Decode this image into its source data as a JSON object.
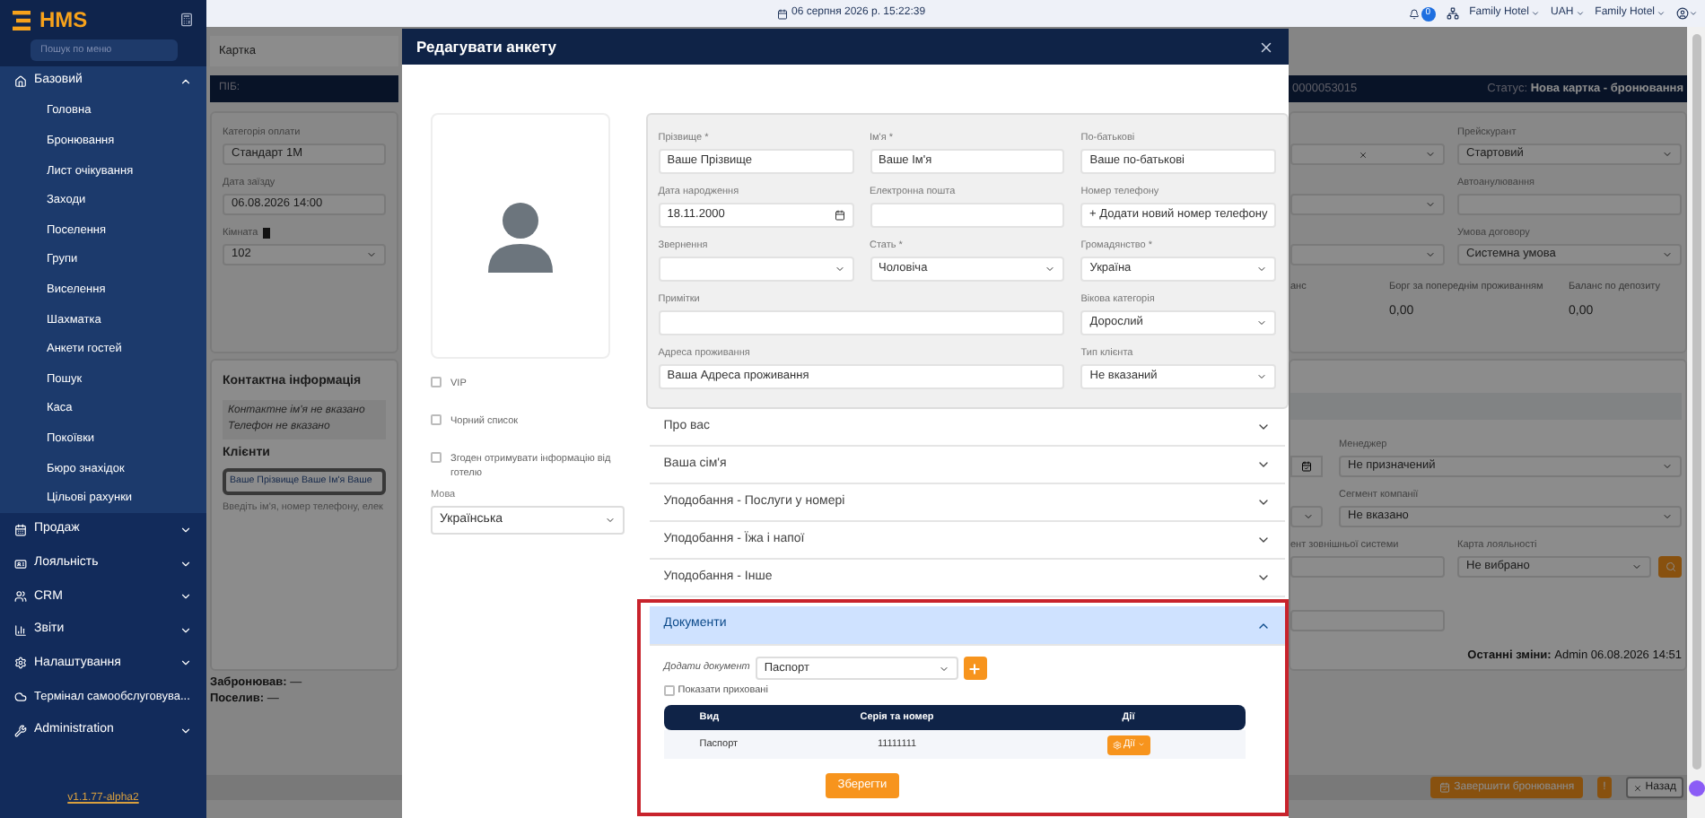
{
  "sidebar": {
    "logo": "HMS",
    "search_placeholder": "Пошук по меню",
    "items": [
      {
        "label": "Базовий",
        "kind": "group",
        "expanded": true,
        "children": [
          {
            "label": "Головна"
          },
          {
            "label": "Бронювання"
          },
          {
            "label": "Лист очікування"
          },
          {
            "label": "Заходи"
          },
          {
            "label": "Поселення"
          },
          {
            "label": "Групи"
          },
          {
            "label": "Виселення"
          },
          {
            "label": "Шахматка"
          },
          {
            "label": "Анкети гостей"
          },
          {
            "label": "Пошук"
          },
          {
            "label": "Каса"
          },
          {
            "label": "Покоївки"
          },
          {
            "label": "Бюро знахідок"
          },
          {
            "label": "Цільові рахунки"
          }
        ]
      },
      {
        "label": "Продаж",
        "kind": "group",
        "expanded": false
      },
      {
        "label": "Лояльність",
        "kind": "group",
        "expanded": false
      },
      {
        "label": "CRM",
        "kind": "group",
        "expanded": false
      },
      {
        "label": "Звіти",
        "kind": "group",
        "expanded": false
      },
      {
        "label": "Налаштування",
        "kind": "group",
        "expanded": false
      },
      {
        "label": "Термінал самообслуговува...",
        "kind": "link"
      },
      {
        "label": "Administration",
        "kind": "group",
        "expanded": false
      }
    ],
    "version": "v1.1.77-alpha2"
  },
  "topbar": {
    "datetime": "06 серпня 2026 р. 15:22:39",
    "notifications": "0",
    "menus": [
      "Family Hotel",
      "UAH",
      "Family Hotel"
    ]
  },
  "background": {
    "tab": "Картка",
    "left": {
      "name_label": "ПІБ:",
      "fields": [
        {
          "label": "Категорія оплати",
          "value": "Стандарт 1М",
          "kind": "input"
        },
        {
          "label": "Дата заїзду",
          "value": "06.08.2026 14:00",
          "kind": "input"
        },
        {
          "label": "Кімната",
          "value": "102",
          "kind": "select"
        }
      ],
      "contact_title": "Контактна інформація",
      "contact_name": "Контактне ім'я не вказано",
      "contact_phone": "Телефон не вказано",
      "clients_title": "Клієнти",
      "client_value": "Ваше Прізвище Ваше Ім'я Ваше",
      "client_hint": "Введіть ім'я, номер телефону, елек",
      "booked_by": "Забронював:",
      "booked_by_value": "—",
      "settled_by": "Поселив:",
      "settled_by_value": "—"
    },
    "right": {
      "card_number": "0000053015",
      "status_label": "Статус:",
      "status_value": "Нова картка - бронювання",
      "fields": [
        {
          "label": "Прейскурант",
          "value": "Стартовий",
          "kind": "select"
        },
        {
          "label": "Автоанулювання",
          "kind": "input"
        },
        {
          "label": "Умова договору",
          "value": "Системна умова",
          "kind": "select"
        }
      ],
      "balances": [
        {
          "label": "анс"
        },
        {
          "label": "Борг за попереднім проживанням",
          "value": "0,00"
        },
        {
          "label": "Баланс по депозиту",
          "value": "0,00"
        }
      ],
      "manager_label": "Менеджер",
      "manager_value": "Не призначений",
      "segment_label": "Сегмент компанії",
      "segment_value": "Не вказано",
      "external_label": "ент зовнішньої системи",
      "loyalty_label": "Карта лояльності",
      "loyalty_value": "Не вибрано",
      "last_change_label": "Останні зміни:",
      "last_change_value": "Admin 06.08.2026 14:51"
    },
    "footer_buttons": [
      {
        "label": "Завершити бронювання",
        "kind": "primary"
      },
      {
        "label": "!",
        "kind": "warning"
      },
      {
        "label": "Назад",
        "kind": "back"
      }
    ]
  },
  "modal": {
    "title": "Редагувати анкету",
    "flags": [
      {
        "label": "VIP",
        "checked": false
      },
      {
        "label": "Чорний список",
        "checked": false
      },
      {
        "label": "Згоден отримувати інформацію від готелю",
        "checked": false
      }
    ],
    "language_label": "Мова",
    "language_value": "Українська",
    "fields": [
      {
        "label": "Прізвище *",
        "value": "Ваше Прізвище",
        "kind": "text"
      },
      {
        "label": "Ім'я *",
        "value": "Ваше Ім'я",
        "kind": "text"
      },
      {
        "label": "По-батькові",
        "value": "Ваше по-батькові",
        "kind": "text"
      },
      {
        "label": "Дата народження",
        "value": "18.11.2000",
        "kind": "date"
      },
      {
        "label": "Електронна пошта",
        "kind": "text"
      },
      {
        "label": "Номер телефону",
        "value": "+ Додати новий номер телефону",
        "kind": "button"
      },
      {
        "label": "Звернення",
        "kind": "select"
      },
      {
        "label": "Стать *",
        "value": "Чоловіча",
        "kind": "select"
      },
      {
        "label": "Громадянство *",
        "value": "Україна",
        "kind": "select"
      },
      {
        "label": "Примітки",
        "kind": "wide_text"
      },
      {
        "label": "Вікова категорія",
        "value": "Дорослий",
        "kind": "select"
      },
      {
        "label": "Адреса проживання",
        "value": "Ваша Адреса проживання",
        "kind": "wide_text"
      },
      {
        "label": "Тип клієнта",
        "value": "Не вказаний",
        "kind": "select"
      }
    ],
    "sections": [
      {
        "title": "Про вас",
        "expanded": false
      },
      {
        "title": "Ваша сім'я",
        "expanded": false
      },
      {
        "title": "Уподобання - Послуги у номері",
        "expanded": false
      },
      {
        "title": "Уподобання - Їжа і напої",
        "expanded": false
      },
      {
        "title": "Уподобання - Інше",
        "expanded": false
      },
      {
        "title": "Документи",
        "expanded": true,
        "documents": {
          "add_label": "Додати документ",
          "add_value": "Паспорт",
          "show_hidden": {
            "label": "Показати приховані",
            "checked": false
          },
          "columns": [
            "Вид",
            "Серія та номер",
            "Дії"
          ],
          "rows": [
            {
              "type": "Паспорт",
              "number": "11111111",
              "action": "Дії"
            }
          ],
          "save": "Зберегти"
        }
      }
    ]
  },
  "highlight_frame": true
}
